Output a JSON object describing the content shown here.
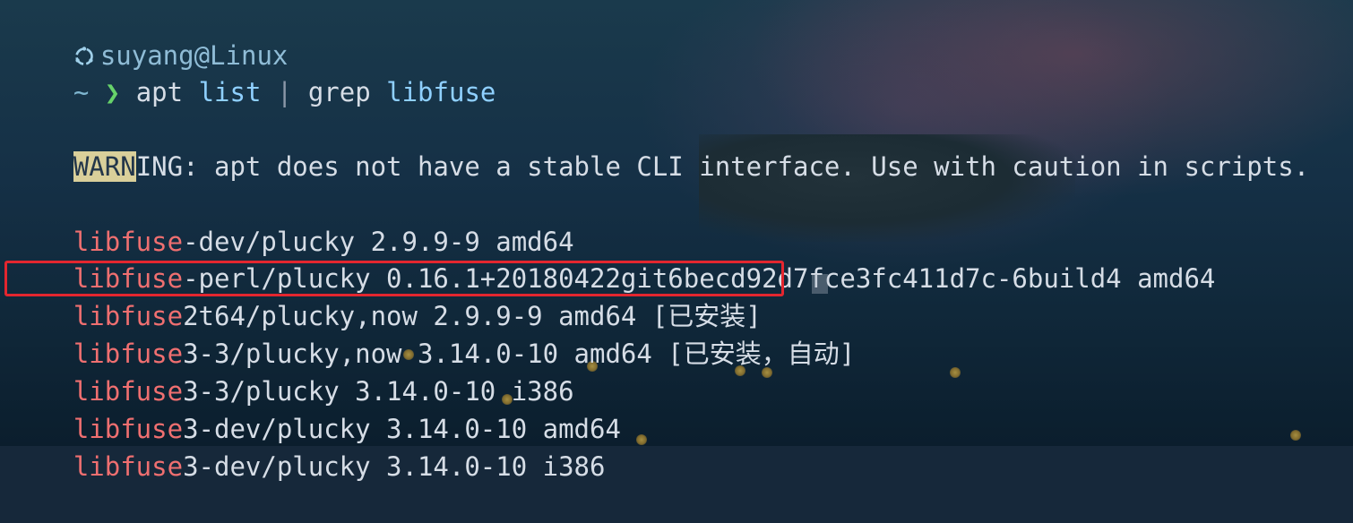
{
  "terminal": {
    "user": "suyang@Linux",
    "prompt_tilde": "~",
    "prompt_chevron": "❯",
    "command": {
      "part1": "apt",
      "part2": "list",
      "pipe": "|",
      "part3": "grep",
      "part4": "libfuse"
    },
    "warning": {
      "highlight": "WARN",
      "rest": "ING: apt does not have a stable CLI interface. Use with caution in scripts."
    },
    "results": [
      {
        "match": "libfuse",
        "rest": "-dev/plucky 2.9.9-9 amd64"
      },
      {
        "match": "libfuse",
        "rest": "-perl/plucky 0.16.1+20180422git6becd92d7fce3fc411d7c-6build4 amd64"
      },
      {
        "match": "libfuse",
        "rest": "2t64/plucky,now 2.9.9-9 amd64 [已安装]"
      },
      {
        "match": "libfuse",
        "rest": "3-3/plucky,now 3.14.0-10 amd64 [已安装，自动]"
      },
      {
        "match": "libfuse",
        "rest": "3-3/plucky 3.14.0-10 i386"
      },
      {
        "match": "libfuse",
        "rest": "3-dev/plucky 3.14.0-10 amd64"
      },
      {
        "match": "libfuse",
        "rest": "3-dev/plucky 3.14.0-10 i386"
      }
    ]
  },
  "colors": {
    "match": "#ef6f70",
    "highlight_box": "#e3262f",
    "warn_highlight": "#d9cf9a",
    "background": "#16283a"
  },
  "icons": {
    "user_icon": "ubuntu-icon"
  }
}
